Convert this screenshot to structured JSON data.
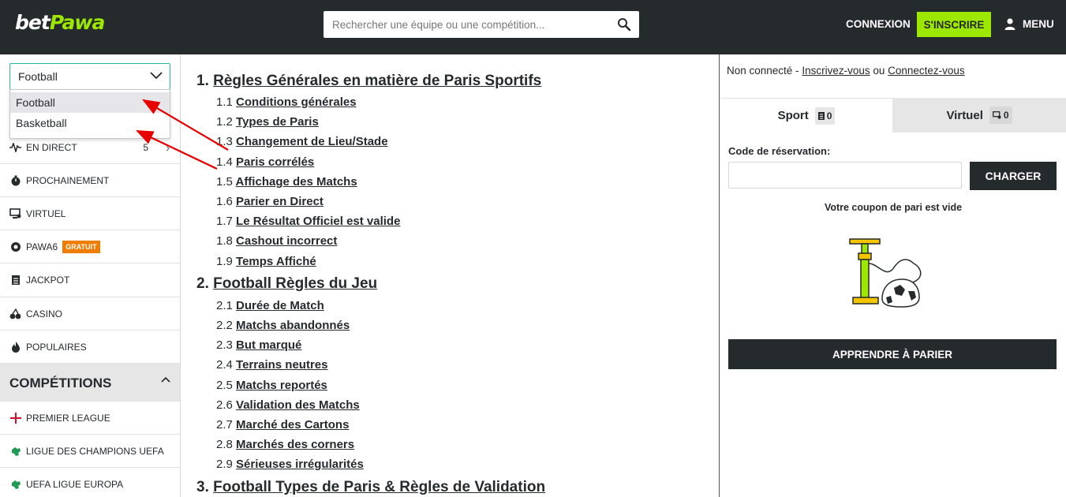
{
  "header": {
    "logo_bet": "bet",
    "logo_pawa": "Pawa",
    "search_placeholder": "Rechercher une équipe ou une compétition...",
    "login": "CONNEXION",
    "signup": "S'INSCRIRE",
    "menu": "MENU",
    "colors": {
      "bar": "#252a2d",
      "accent": "#9ce800"
    }
  },
  "sidebar": {
    "sport_select": {
      "value": "Football",
      "options": [
        "Football",
        "Basketball"
      ]
    },
    "items": [
      {
        "label": "EN DIRECT",
        "icon": "live-pulse-icon",
        "count": "5"
      },
      {
        "label": "PROCHAINEMENT",
        "icon": "stopwatch-icon"
      },
      {
        "label": "VIRTUEL",
        "icon": "virtual-screen-icon"
      },
      {
        "label": "PAWA6",
        "icon": "pawa6-icon",
        "badge": "GRATUIT"
      },
      {
        "label": "JACKPOT",
        "icon": "jackpot-icon"
      },
      {
        "label": "CASINO",
        "icon": "cherries-icon"
      },
      {
        "label": "POPULAIRES",
        "icon": "flame-icon"
      }
    ],
    "competitions_title": "COMPÉTITIONS",
    "competitions": [
      {
        "label": "PREMIER LEAGUE",
        "icon": "england-flag-icon"
      },
      {
        "label": "LIGUE DES CHAMPIONS UEFA",
        "icon": "world-icon"
      },
      {
        "label": "UEFA LIGUE EUROPA",
        "icon": "world-icon"
      }
    ]
  },
  "rules": {
    "sections": [
      {
        "num": "1.",
        "title": "Règles Générales en matière de Paris Sportifs",
        "items": [
          {
            "num": "1.1",
            "title": "Conditions générales"
          },
          {
            "num": "1.2",
            "title": "Types de Paris"
          },
          {
            "num": "1.3",
            "title": "Changement de Lieu/Stade"
          },
          {
            "num": "1.4",
            "title": "Paris corrélés"
          },
          {
            "num": "1.5",
            "title": "Affichage des Matchs"
          },
          {
            "num": "1.6",
            "title": "Parier en Direct"
          },
          {
            "num": "1.7",
            "title": "Le Résultat Officiel est valide"
          },
          {
            "num": "1.8",
            "title": "Cashout incorrect"
          },
          {
            "num": "1.9",
            "title": "Temps Affiché"
          }
        ]
      },
      {
        "num": "2.",
        "title": "Football Règles du Jeu",
        "items": [
          {
            "num": "2.1",
            "title": "Durée de Match"
          },
          {
            "num": "2.2",
            "title": "Matchs abandonnés"
          },
          {
            "num": "2.3",
            "title": "But marqué"
          },
          {
            "num": "2.4",
            "title": "Terrains neutres"
          },
          {
            "num": "2.5",
            "title": "Matchs reportés"
          },
          {
            "num": "2.6",
            "title": "Validation des Matchs"
          },
          {
            "num": "2.7",
            "title": "Marché des Cartons"
          },
          {
            "num": "2.8",
            "title": "Marchés des corners"
          },
          {
            "num": "2.9",
            "title": "Sérieuses irrégularités"
          }
        ]
      },
      {
        "num": "3.",
        "title": "Football Types de Paris & Règles de Validation",
        "items": []
      }
    ]
  },
  "betslip": {
    "status_prefix": "Non connecté - ",
    "status_register": "Inscrivez-vous",
    "status_or": " ou ",
    "status_login": "Connectez-vous",
    "tab_sport": "Sport",
    "tab_sport_count": "0",
    "tab_virtual": "Virtuel",
    "tab_virtual_count": "0",
    "reservation_label": "Code de réservation:",
    "reservation_value": "",
    "load_button": "CHARGER",
    "empty_message": "Votre coupon de pari est vide",
    "learn_button": "APPRENDRE À PARIER"
  }
}
